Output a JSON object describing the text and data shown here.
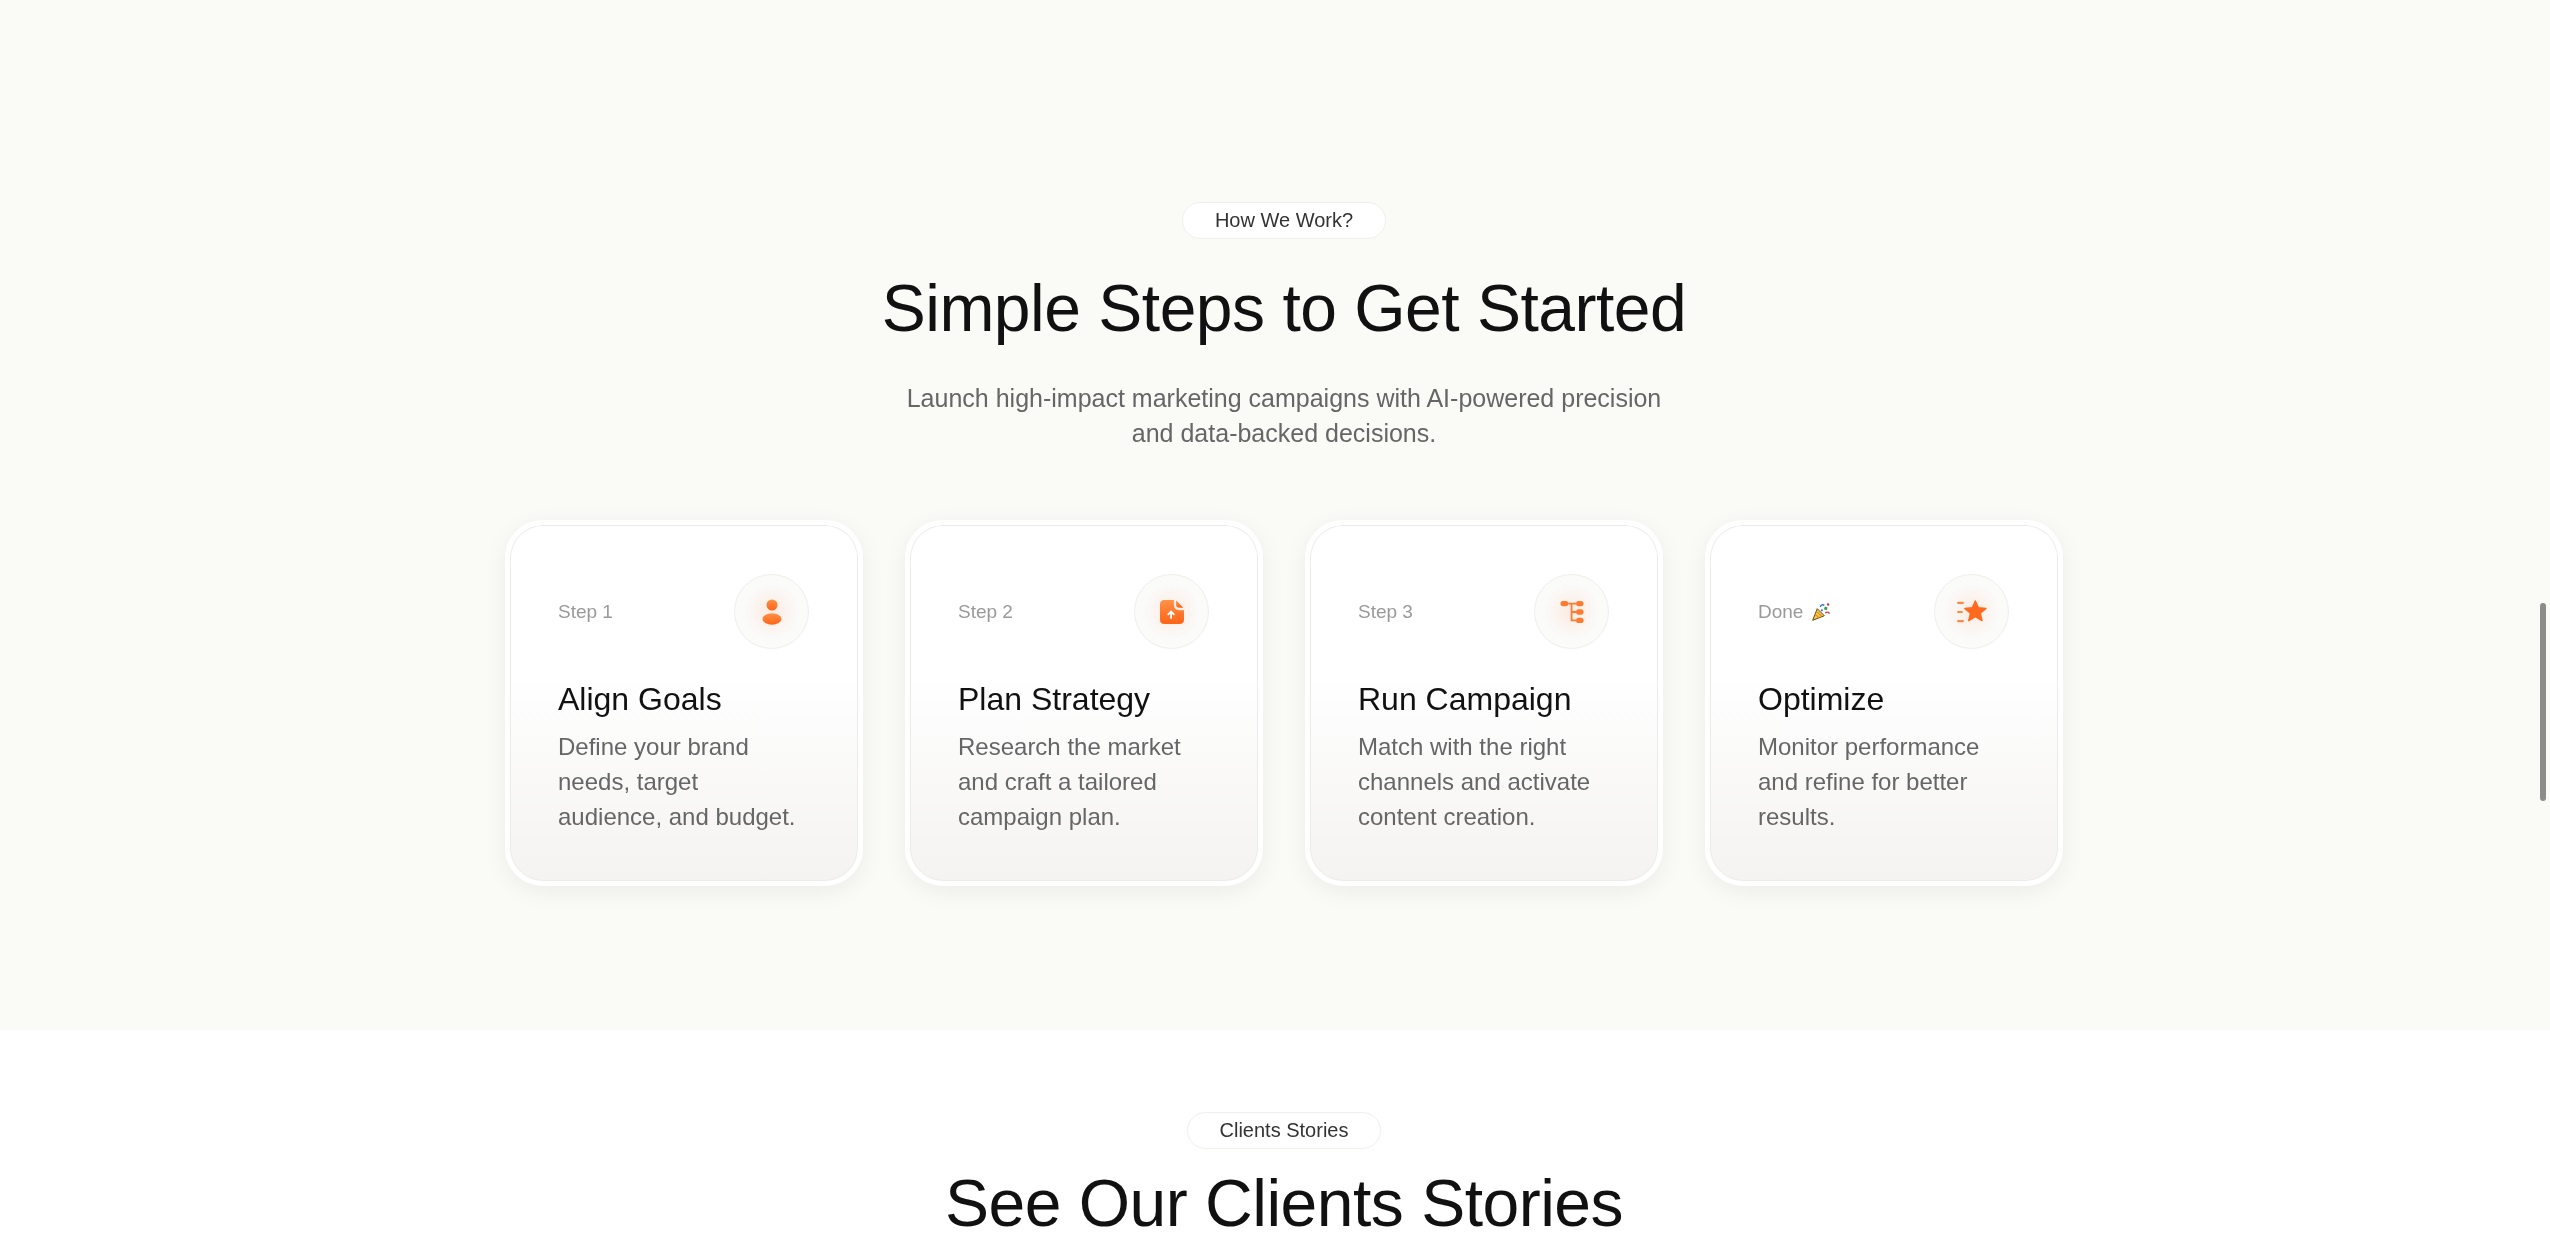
{
  "how_we_work": {
    "badge": "How We Work?",
    "title": "Simple Steps to Get Started",
    "subtitle": "Launch high-impact marketing campaigns with AI-powered precision and data-backed decisions.",
    "steps": [
      {
        "kind": "step",
        "label": "Step 1",
        "title": "Align Goals",
        "description": "Define your brand needs, target audience, and budget."
      },
      {
        "kind": "step",
        "label": "Step 2",
        "title": "Plan Strategy",
        "description": "Research the market and craft a tailored campaign plan."
      },
      {
        "kind": "step",
        "label": "Step 3",
        "title": "Run Campaign",
        "description": "Match with the right channels and activate content creation."
      },
      {
        "kind": "done",
        "label": "Done",
        "title": "Optimize",
        "description": "Monitor performance and refine for better results."
      }
    ]
  },
  "clients_stories": {
    "badge": "Clients Stories",
    "title": "See Our Clients Stories"
  }
}
